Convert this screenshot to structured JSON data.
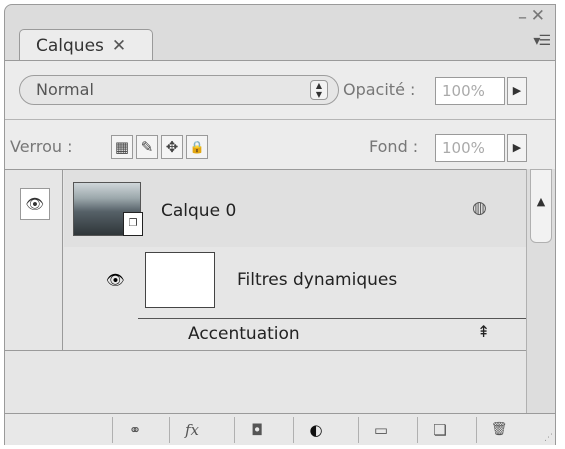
{
  "panel": {
    "tab_label": "Calques",
    "tab_close_glyph": "✕",
    "minimize_glyph": "–",
    "close_glyph": "✕",
    "flyout_glyph": "▾☰"
  },
  "blend": {
    "mode": "Normal",
    "arrows_glyph": "▲\n▼"
  },
  "opacity": {
    "label": "Opacité :",
    "value": "100%",
    "arrow": "▶"
  },
  "lock": {
    "label": "Verrou :",
    "icons": [
      "lock-transparent-icon",
      "lock-brush-icon",
      "lock-move-icon",
      "lock-all-icon"
    ],
    "glyphs": [
      "▦",
      "✎",
      "✥",
      "🔒"
    ]
  },
  "fill": {
    "label": "Fond :",
    "value": "100%",
    "arrow": "▶"
  },
  "layers": [
    {
      "name": "Calque 0",
      "visible_glyph": "👁",
      "smart_object_glyph": "❐",
      "smart_filter_glyph": "◍",
      "smart_filters": {
        "label": "Filtres dynamiques",
        "visible_glyph": "👁",
        "items": [
          {
            "name": "Accentuation",
            "options_glyph": "⇞"
          }
        ]
      }
    }
  ],
  "scroll": {
    "up_glyph": "▲"
  },
  "toolbar": {
    "buttons": [
      {
        "name": "link-layers-icon",
        "glyph": "⚭"
      },
      {
        "name": "fx-icon",
        "glyph": "fx"
      },
      {
        "name": "add-mask-icon",
        "glyph": "◘"
      },
      {
        "name": "adjustment-layer-icon",
        "glyph": "◐"
      },
      {
        "name": "new-group-icon",
        "glyph": "▭"
      },
      {
        "name": "new-layer-icon",
        "glyph": "❏"
      },
      {
        "name": "trash-icon",
        "glyph": "🗑"
      }
    ],
    "grip_glyph": "⋰"
  }
}
